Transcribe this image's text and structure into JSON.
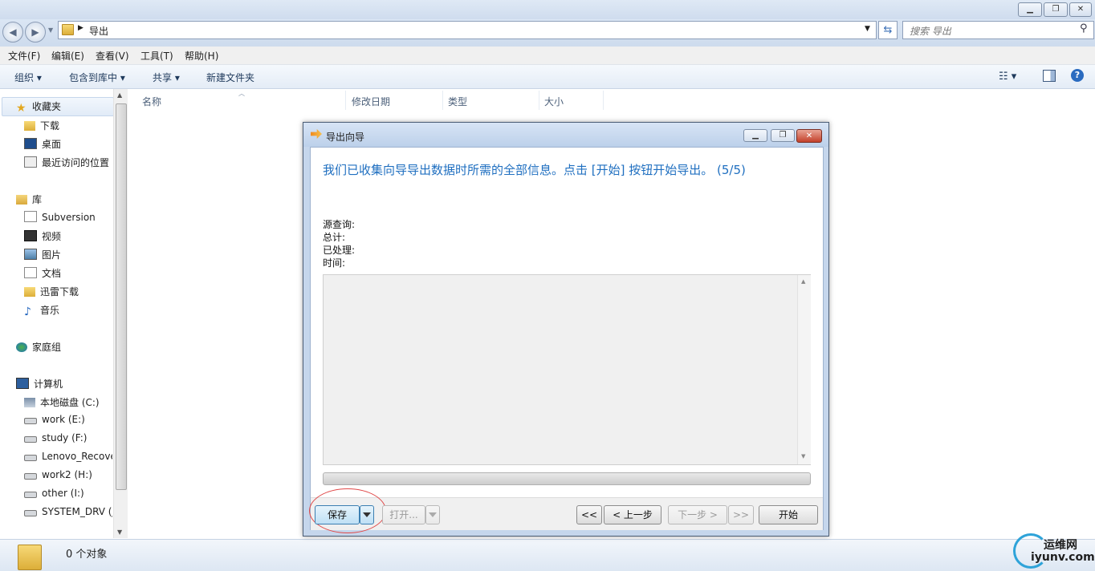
{
  "window": {
    "minimize_glyph": "▁",
    "restore_glyph": "❐",
    "close_glyph": "✕"
  },
  "address": {
    "path": "导出",
    "search_placeholder": "搜索 导出"
  },
  "menubar": [
    "文件(F)",
    "编辑(E)",
    "查看(V)",
    "工具(T)",
    "帮助(H)"
  ],
  "toolbar": {
    "organize": "组织 ▾",
    "include_library": "包含到库中 ▾",
    "share": "共享 ▾",
    "new_folder": "新建文件夹"
  },
  "nav": {
    "favorites": {
      "label": "收藏夹",
      "items": [
        "下载",
        "桌面",
        "最近访问的位置"
      ]
    },
    "libraries": {
      "label": "库",
      "items": [
        "Subversion",
        "视频",
        "图片",
        "文档",
        "迅雷下载",
        "音乐"
      ]
    },
    "homegroup": {
      "label": "家庭组"
    },
    "computer": {
      "label": "计算机",
      "items": [
        "本地磁盘 (C:)",
        "work (E:)",
        "study (F:)",
        "Lenovo_Recove",
        "work2 (H:)",
        "other (I:)",
        "SYSTEM_DRV (J"
      ]
    }
  },
  "columns": [
    "名称",
    "修改日期",
    "类型",
    "大小"
  ],
  "status": {
    "text": "0 个对象"
  },
  "watermark": {
    "cn": "运维网",
    "url": "iyunv.com"
  },
  "dialog": {
    "title": "导出向导",
    "heading": "我们已收集向导导出数据时所需的全部信息。点击 [开始] 按钮开始导出。 (5/5)",
    "fields": [
      "源查询:",
      "总计:",
      "已处理:",
      "时间:"
    ],
    "progress": 0,
    "buttons": {
      "save": "保存",
      "open": "打开...",
      "first": "<<",
      "prev": "< 上一步",
      "next": "下一步 >",
      "last": ">>",
      "start": "开始"
    }
  },
  "colors": {
    "heading": "#1f6fc0",
    "highlight_ring": "#e04848"
  }
}
